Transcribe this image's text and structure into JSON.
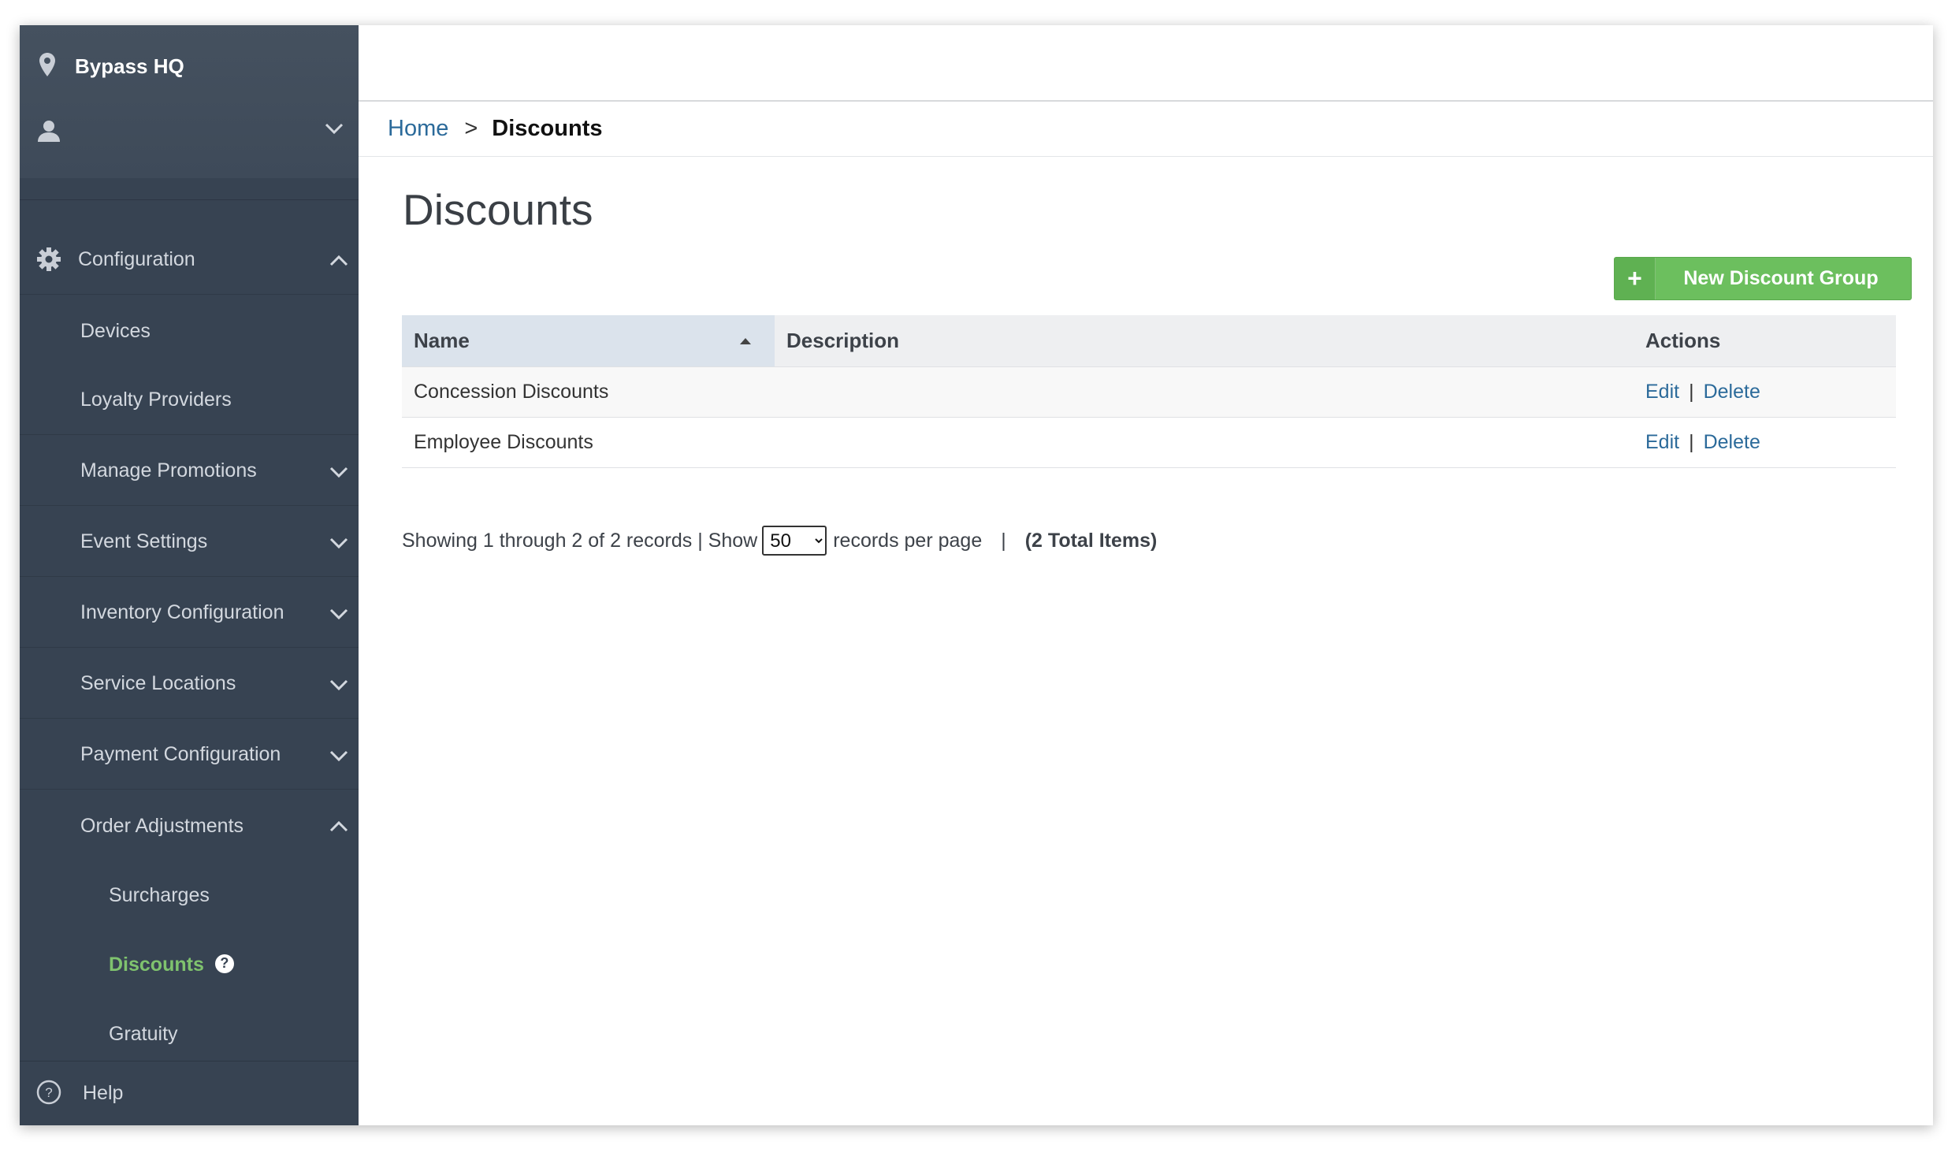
{
  "sidebar": {
    "venue_name": "Bypass HQ",
    "menu": {
      "configuration": "Configuration",
      "devices": "Devices",
      "loyalty_providers": "Loyalty Providers",
      "manage_promotions": "Manage Promotions",
      "event_settings": "Event Settings",
      "inventory_configuration": "Inventory Configuration",
      "service_locations": "Service Locations",
      "payment_configuration": "Payment Configuration",
      "order_adjustments": "Order Adjustments",
      "surcharges": "Surcharges",
      "discounts": "Discounts",
      "gratuity": "Gratuity"
    },
    "discounts_help": "?",
    "help": "Help",
    "colors": {
      "background": "#374352",
      "active": "#7fc36e"
    }
  },
  "breadcrumb": {
    "home": "Home",
    "separator": ">",
    "current": "Discounts"
  },
  "page": {
    "title": "Discounts",
    "new_button": {
      "icon": "+",
      "label": "New Discount Group",
      "color": "#6cbf5e"
    }
  },
  "table": {
    "columns": {
      "name": "Name",
      "description": "Description",
      "actions": "Actions"
    },
    "sorted_by": "Name",
    "sort_direction": "ascending",
    "rows": [
      {
        "name": "Concession Discounts",
        "description": "",
        "edit": "Edit",
        "sep": "|",
        "delete": "Delete"
      },
      {
        "name": "Employee Discounts",
        "description": "",
        "edit": "Edit",
        "sep": "|",
        "delete": "Delete"
      }
    ]
  },
  "pager": {
    "showing": "Showing 1 through 2 of 2 records | Show",
    "per_page_selected": "50",
    "per_page_options": [
      "50"
    ],
    "records_per_page": "records per page",
    "divider": "|",
    "total": "(2 Total Items)"
  },
  "colors": {
    "link": "#2b6a9a"
  }
}
